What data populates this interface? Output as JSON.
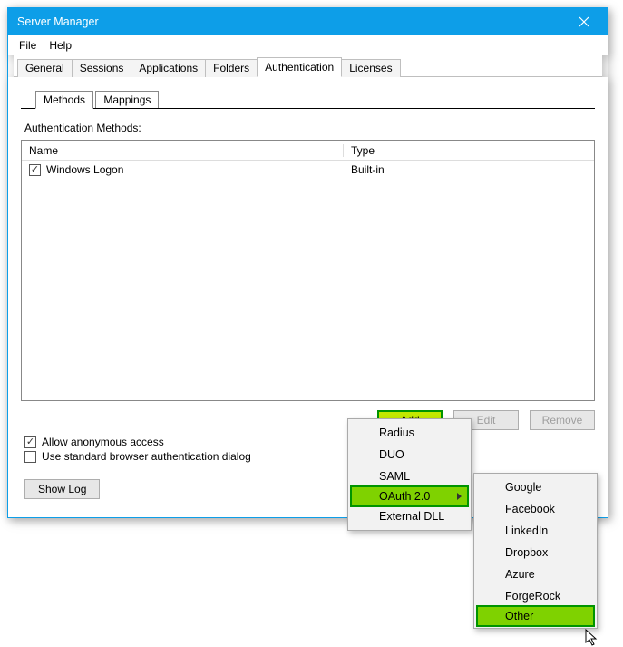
{
  "window": {
    "title": "Server Manager"
  },
  "menubar": {
    "file": "File",
    "help": "Help"
  },
  "tabs": {
    "general": "General",
    "sessions": "Sessions",
    "applications": "Applications",
    "folders": "Folders",
    "authentication": "Authentication",
    "licenses": "Licenses"
  },
  "subtabs": {
    "methods": "Methods",
    "mappings": "Mappings"
  },
  "section": {
    "auth_methods_label": "Authentication Methods:"
  },
  "list_headers": {
    "name": "Name",
    "type": "Type"
  },
  "list_rows": [
    {
      "checked": true,
      "name": "Windows Logon",
      "type": "Built-in"
    }
  ],
  "buttons": {
    "add": "Add",
    "edit": "Edit",
    "remove": "Remove",
    "showlog": "Show Log"
  },
  "checkboxes": {
    "allow_anon": {
      "checked": true,
      "label": "Allow anonymous access"
    },
    "browser_dlg": {
      "checked": false,
      "label": "Use standard browser authentication dialog"
    }
  },
  "menu1": {
    "items": [
      {
        "label": "Radius"
      },
      {
        "label": "DUO"
      },
      {
        "label": "SAML"
      },
      {
        "label": "OAuth 2.0",
        "has_sub": true,
        "highlight": true
      },
      {
        "label": "External DLL"
      }
    ]
  },
  "menu2": {
    "items": [
      {
        "label": "Google"
      },
      {
        "label": "Facebook"
      },
      {
        "label": "LinkedIn"
      },
      {
        "label": "Dropbox"
      },
      {
        "label": "Azure"
      },
      {
        "label": "ForgeRock"
      },
      {
        "label": "Other",
        "highlight": true
      }
    ]
  }
}
